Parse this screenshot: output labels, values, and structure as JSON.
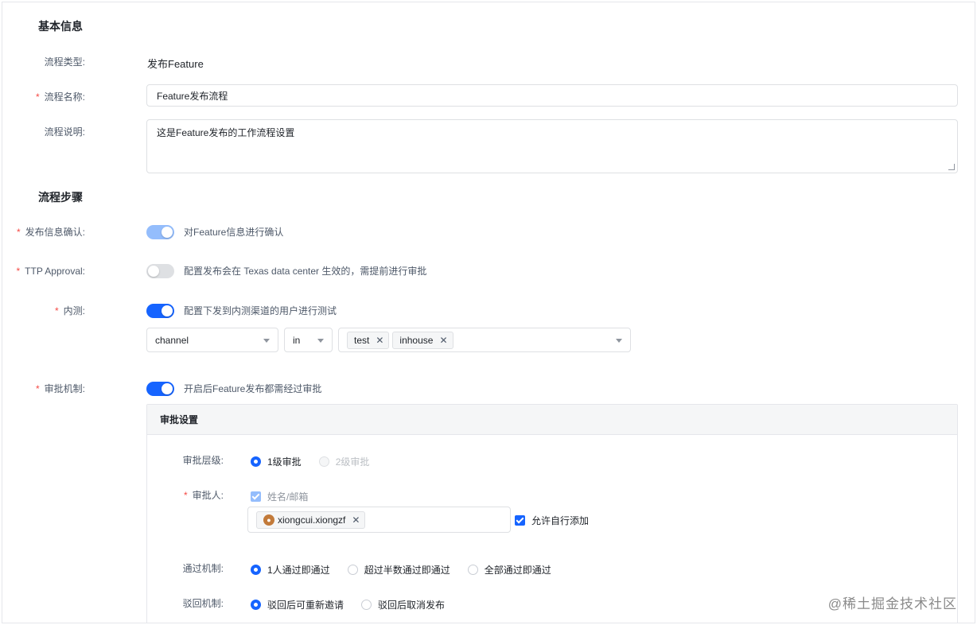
{
  "basic": {
    "title": "基本信息",
    "type_label": "流程类型:",
    "type_value": "发布Feature",
    "name_label": "流程名称:",
    "name_value": "Feature发布流程",
    "desc_label": "流程说明:",
    "desc_value": "这是Feature发布的工作流程设置"
  },
  "steps": {
    "title": "流程步骤",
    "confirm": {
      "label": "发布信息确认:",
      "text": "对Feature信息进行确认",
      "state": "on-disabled"
    },
    "ttp": {
      "label": "TTP Approval:",
      "text": "配置发布会在 Texas data center 生效的，需提前进行审批",
      "state": "off"
    },
    "internal": {
      "label": "内测:",
      "text": "配置下发到内测渠道的用户进行测试",
      "state": "on",
      "field_select": "channel",
      "op_select": "in",
      "tags": [
        "test",
        "inhouse"
      ]
    },
    "approval": {
      "label": "审批机制:",
      "text": "开启后Feature发布都需经过审批",
      "state": "on"
    }
  },
  "approval_panel": {
    "title": "审批设置",
    "level_label": "审批层级:",
    "level_options": [
      "1级审批",
      "2级审批"
    ],
    "approver_label": "审批人:",
    "approver_checkbox": "姓名/邮箱",
    "approver_tag": "xiongcui.xiongzf",
    "allow_self_add": "允许自行添加",
    "pass_label": "通过机制:",
    "pass_options": [
      "1人通过即通过",
      "超过半数通过即通过",
      "全部通过即通过"
    ],
    "reject_label": "驳回机制:",
    "reject_options": [
      "驳回后可重新邀请",
      "驳回后取消发布"
    ]
  },
  "icons": {
    "tag_remove": "close-icon",
    "select_caret": "chevron-down-icon"
  },
  "colors": {
    "accent": "#1664ff",
    "required": "#f54a45",
    "disabled_switch": "#94bdfc"
  },
  "watermark": "@稀土掘金技术社区"
}
